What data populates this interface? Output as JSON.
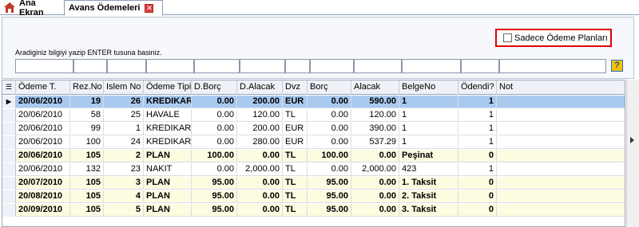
{
  "tabs": [
    {
      "label": "Ana Ekran",
      "icon": "home-icon"
    },
    {
      "label": "Avans Ödemeleri",
      "close_icon": "close-icon"
    }
  ],
  "filter": {
    "only_plans_label": "Sadece Ödeme Planları",
    "only_plans_checked": false,
    "hint": "Aradiginiz bilgiyi yazip ENTER tusuna basiniz.",
    "help_label": "?"
  },
  "grid": {
    "columns": [
      "Ödeme T.",
      "Rez.No",
      "Islem No",
      "Ödeme Tipi",
      "D.Borç",
      "D.Alacak",
      "Dvz",
      "Borç",
      "Alacak",
      "BelgeNo",
      "Ödendi?",
      "Not"
    ],
    "rows": [
      [
        "20/06/2010",
        "19",
        "26",
        "KREDIKART",
        "0.00",
        "200.00",
        "EUR",
        "0.00",
        "590.00",
        "1",
        "1",
        ""
      ],
      [
        "20/06/2010",
        "58",
        "25",
        "HAVALE",
        "0.00",
        "120.00",
        "TL",
        "0.00",
        "120.00",
        "1",
        "1",
        ""
      ],
      [
        "20/06/2010",
        "99",
        "1",
        "KREDIKART",
        "0.00",
        "200.00",
        "EUR",
        "0.00",
        "390.00",
        "1",
        "1",
        ""
      ],
      [
        "20/06/2010",
        "100",
        "24",
        "KREDIKART",
        "0.00",
        "280.00",
        "EUR",
        "0.00",
        "537.29",
        "1",
        "1",
        ""
      ],
      [
        "20/06/2010",
        "105",
        "2",
        "PLAN",
        "100.00",
        "0.00",
        "TL",
        "100.00",
        "0.00",
        "Peşinat",
        "0",
        ""
      ],
      [
        "20/06/2010",
        "132",
        "23",
        "NAKIT",
        "0.00",
        "2,000.00",
        "TL",
        "0.00",
        "2,000.00",
        "423",
        "1",
        ""
      ],
      [
        "20/07/2010",
        "105",
        "3",
        "PLAN",
        "95.00",
        "0.00",
        "TL",
        "95.00",
        "0.00",
        "1. Taksit",
        "0",
        ""
      ],
      [
        "20/08/2010",
        "105",
        "4",
        "PLAN",
        "95.00",
        "0.00",
        "TL",
        "95.00",
        "0.00",
        "2. Taksit",
        "0",
        ""
      ],
      [
        "20/09/2010",
        "105",
        "5",
        "PLAN",
        "95.00",
        "0.00",
        "TL",
        "95.00",
        "0.00",
        "3. Taksit",
        "0",
        ""
      ]
    ],
    "selected_row": 0
  }
}
